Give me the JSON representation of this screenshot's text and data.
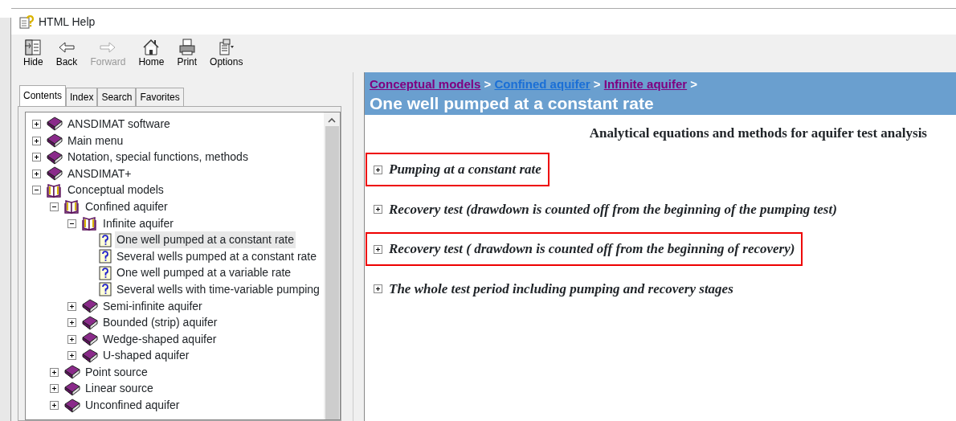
{
  "window": {
    "title": "HTML Help"
  },
  "toolbar": [
    {
      "label": "Hide",
      "kind": "hide",
      "disabled": false
    },
    {
      "label": "Back",
      "kind": "back",
      "disabled": false
    },
    {
      "label": "Forward",
      "kind": "forward",
      "disabled": true
    },
    {
      "label": "Home",
      "kind": "home",
      "disabled": false
    },
    {
      "label": "Print",
      "kind": "print",
      "disabled": false
    },
    {
      "label": "Options",
      "kind": "options",
      "disabled": false
    }
  ],
  "tabs": [
    {
      "label": "Contents",
      "selected": true
    },
    {
      "label": "Index",
      "selected": false
    },
    {
      "label": "Search",
      "selected": false
    },
    {
      "label": "Favorites",
      "selected": false
    }
  ],
  "tree": [
    {
      "kind": "book",
      "label": "ANSDIMAT software",
      "expanded": false
    },
    {
      "kind": "book",
      "label": "Main menu",
      "expanded": false
    },
    {
      "kind": "book",
      "label": "Notation, special functions, methods",
      "expanded": false
    },
    {
      "kind": "book",
      "label": "ANSDIMAT+",
      "expanded": false
    },
    {
      "kind": "book",
      "label": "Conceptual models",
      "expanded": true,
      "children": [
        {
          "kind": "book",
          "label": "Confined aquifer",
          "expanded": true,
          "children": [
            {
              "kind": "book",
              "label": "Infinite aquifer",
              "expanded": true,
              "children": [
                {
                  "kind": "topic",
                  "label": "One well pumped at a constant rate",
                  "selected": true
                },
                {
                  "kind": "topic",
                  "label": "Several wells pumped at a constant rate",
                  "selected": false
                },
                {
                  "kind": "topic",
                  "label": "One well pumped at a variable rate",
                  "selected": false
                },
                {
                  "kind": "topic",
                  "label": "Several wells with time-variable pumping",
                  "selected": false
                }
              ]
            },
            {
              "kind": "book",
              "label": "Semi-infinite aquifer",
              "expanded": false
            },
            {
              "kind": "book",
              "label": "Bounded (strip) aquifer",
              "expanded": false
            },
            {
              "kind": "book",
              "label": "Wedge-shaped aquifer",
              "expanded": false
            },
            {
              "kind": "book",
              "label": "U-shaped aquifer",
              "expanded": false
            }
          ]
        },
        {
          "kind": "book",
          "label": "Point source",
          "expanded": false
        },
        {
          "kind": "book",
          "label": "Linear source",
          "expanded": false
        },
        {
          "kind": "book",
          "label": "Unconfined aquifer",
          "expanded": false
        }
      ]
    }
  ],
  "page": {
    "breadcrumbs": [
      {
        "label": "Conceptual models",
        "visited": true
      },
      {
        "label": "Confined aquifer",
        "visited": false
      },
      {
        "label": "Infinite aquifer",
        "visited": true
      }
    ],
    "separator": ">",
    "title": "One well pumped at a constant rate",
    "subtitle": "Analytical equations and methods for aquifer test analysis",
    "sections": [
      {
        "label": "Pumping at a constant rate",
        "highlighted": true
      },
      {
        "label": "Recovery test (drawdown is counted off from the beginning of the pumping test)",
        "highlighted": false
      },
      {
        "label": "Recovery test ( drawdown is counted off from the beginning of recovery)",
        "highlighted": true
      },
      {
        "label": "The whole test period including pumping and recovery stages",
        "highlighted": false
      }
    ]
  }
}
